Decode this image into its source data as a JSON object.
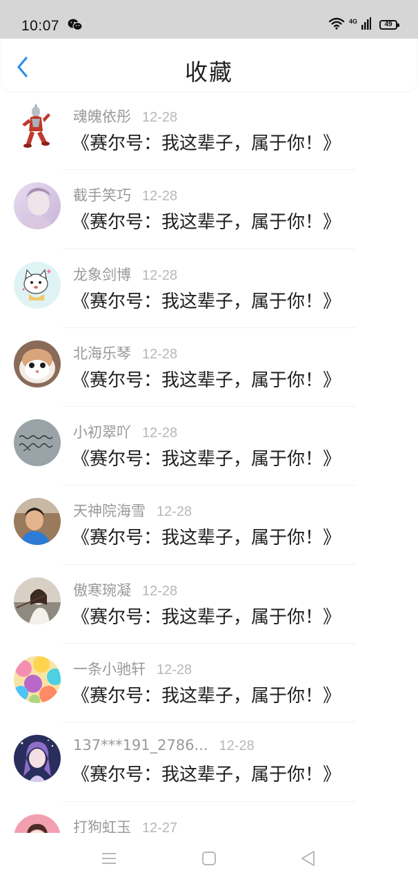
{
  "status_bar": {
    "time": "10:07",
    "network": "4G",
    "battery": "49"
  },
  "header": {
    "title": "收藏",
    "back_icon": "chevron-left-icon",
    "accent_color": "#2a8ee8"
  },
  "items": [
    {
      "author": "魂魄依彤",
      "date": "12-28",
      "title": "《赛尔号：我这辈子，属于你！》"
    },
    {
      "author": "截手笑巧",
      "date": "12-28",
      "title": "《赛尔号：我这辈子，属于你！》"
    },
    {
      "author": "龙象剑博",
      "date": "12-28",
      "title": "《赛尔号：我这辈子，属于你！》"
    },
    {
      "author": "北海乐琴",
      "date": "12-28",
      "title": "《赛尔号：我这辈子，属于你！》"
    },
    {
      "author": "小初翠吖",
      "date": "12-28",
      "title": "《赛尔号：我这辈子，属于你！》"
    },
    {
      "author": "天神院海雪",
      "date": "12-28",
      "title": "《赛尔号：我这辈子，属于你！》"
    },
    {
      "author": "傲寒琬凝",
      "date": "12-28",
      "title": "《赛尔号：我这辈子，属于你！》"
    },
    {
      "author": "一条小驰轩",
      "date": "12-28",
      "title": "《赛尔号：我这辈子，属于你！》"
    },
    {
      "author": "137***191_2786...",
      "date": "12-28",
      "title": "《赛尔号：我这辈子，属于你！》"
    },
    {
      "author": "打狗虹玉",
      "date": "12-27",
      "title": ""
    }
  ],
  "nav_bar": {
    "icons": [
      "menu-icon",
      "home-square-icon",
      "back-triangle-icon"
    ]
  }
}
